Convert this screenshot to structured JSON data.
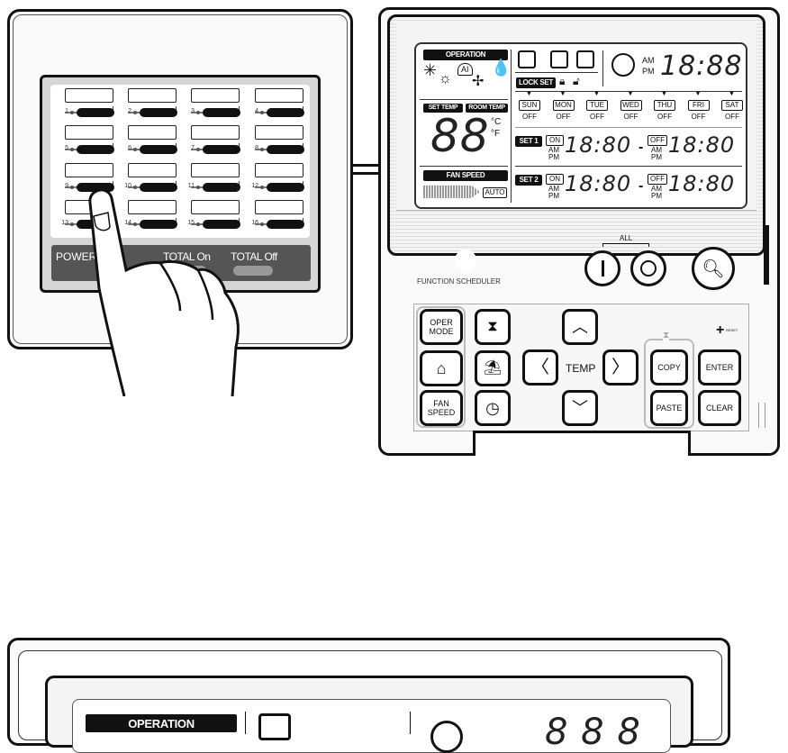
{
  "zone_panel": {
    "zones": [
      "1",
      "2",
      "3",
      "4",
      "5",
      "6",
      "7",
      "8",
      "9",
      "10",
      "11",
      "12",
      "13",
      "14",
      "15",
      "16"
    ],
    "power_label": "POWER",
    "total_on_label": "TOTAL On",
    "total_off_label": "TOTAL Off"
  },
  "lcd": {
    "operation_label": "OPERATION",
    "ai_label": "AI",
    "lock_set_label": "LOCK SET",
    "set_temp_label": "SET TEMP",
    "room_temp_label": "ROOM TEMP",
    "temp_digits": "88",
    "celsius": "°C",
    "fahrenheit": "°F",
    "fan_speed_label": "FAN SPEED",
    "auto_label": "AUTO",
    "am": "AM",
    "pm": "PM",
    "clock_digits": "18:88",
    "days": [
      "SUN",
      "MON",
      "TUE",
      "WED",
      "THU",
      "FRI",
      "SAT"
    ],
    "day_status": "OFF",
    "set1_label": "SET 1",
    "set2_label": "SET 2",
    "on_label": "ON",
    "off_label": "OFF",
    "time_digits": "18:80",
    "dash": "-"
  },
  "controller": {
    "function_label": "FUNCTION SCHEDULER",
    "all_label": "ALL",
    "oper_mode_label": "OPER\nMODE",
    "fan_speed_label": "FAN\nSPEED",
    "temp_label": "TEMP",
    "copy_label": "COPY",
    "paste_label": "PASTE",
    "enter_label": "ENTER",
    "clear_label": "CLEAR",
    "reset_label": "RESET"
  },
  "bottom_lcd": {
    "operation_label": "OPERATION"
  }
}
